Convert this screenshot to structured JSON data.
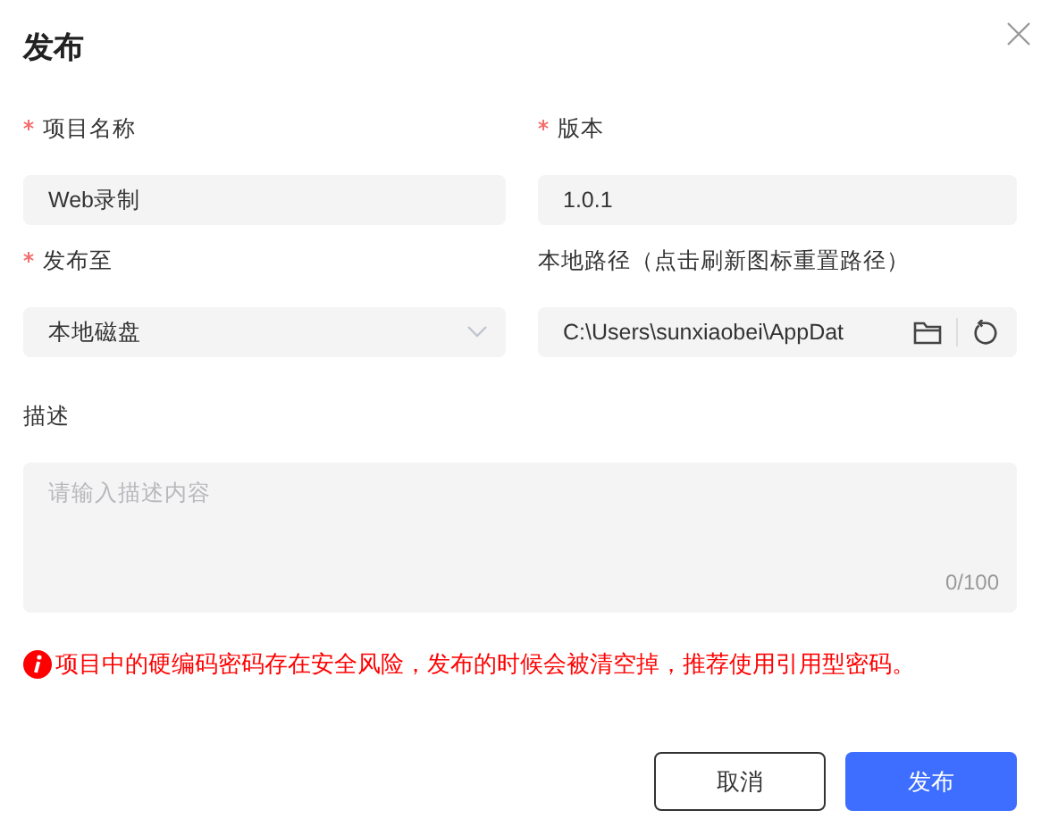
{
  "dialog": {
    "title": "发布"
  },
  "fields": [
    {
      "kind": "text",
      "label": "项目名称",
      "required": true,
      "value": "Web录制"
    },
    {
      "kind": "text",
      "label": "版本",
      "required": true,
      "value": "1.0.1"
    },
    {
      "kind": "select",
      "label": "发布至",
      "required": true,
      "value": "本地磁盘"
    },
    {
      "kind": "path",
      "label": "本地路径（点击刷新图标重置路径）",
      "required": false,
      "value": "C:\\Users\\sunxiaobei\\AppDat"
    }
  ],
  "description": {
    "label": "描述",
    "placeholder": "请输入描述内容",
    "counter": "0/100"
  },
  "warning": "项目中的硬编码密码存在安全风险，发布的时候会被清空掉，推荐使用引用型密码。",
  "buttons": [
    {
      "label": "取消",
      "kind": "secondary"
    },
    {
      "label": "发布",
      "kind": "primary"
    }
  ]
}
